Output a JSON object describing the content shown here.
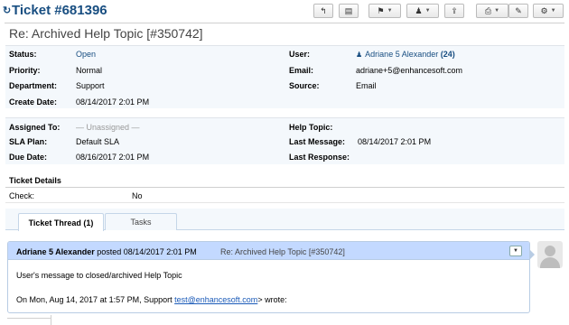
{
  "header": {
    "refresh_icon": "refresh-icon",
    "title": "Ticket #681396",
    "toolbar": [
      {
        "name": "back-button",
        "icon": "↰",
        "caret": false
      },
      {
        "name": "note-button",
        "icon": "▤",
        "caret": false
      },
      {
        "name": "flag-button",
        "icon": "⚑",
        "caret": true
      },
      {
        "name": "assign-button",
        "icon": "♟",
        "caret": true
      },
      {
        "name": "transfer-button",
        "icon": "⇪",
        "caret": false
      },
      {
        "name": "print-button",
        "icon": "⎙",
        "caret": true
      },
      {
        "name": "edit-button",
        "icon": "✎",
        "caret": false
      },
      {
        "name": "settings-button",
        "icon": "⚙",
        "caret": true
      }
    ]
  },
  "subject": "Re: Archived Help Topic [#350742]",
  "info": {
    "status_label": "Status:",
    "status": "Open",
    "priority_label": "Priority:",
    "priority": "Normal",
    "department_label": "Department:",
    "department": "Support",
    "create_date_label": "Create Date:",
    "create_date": "08/14/2017 2:01 PM",
    "user_label": "User:",
    "user_name": "Adriane 5 Alexander",
    "user_count": "(24)",
    "email_label": "Email:",
    "email": "adriane+5@enhancesoft.com",
    "source_label": "Source:",
    "source": "Email"
  },
  "assignment": {
    "assigned_to_label": "Assigned To:",
    "assigned_to": "— Unassigned —",
    "sla_plan_label": "SLA Plan:",
    "sla_plan": "Default SLA",
    "due_date_label": "Due Date:",
    "due_date": "08/16/2017 2:01 PM",
    "help_topic_label": "Help Topic:",
    "help_topic": "",
    "last_message_label": "Last Message:",
    "last_message": "08/14/2017 2:01 PM",
    "last_response_label": "Last Response:",
    "last_response": ""
  },
  "details": {
    "title": "Ticket Details",
    "check_label": "Check:",
    "check_value": "No"
  },
  "tabs": [
    {
      "label": "Ticket Thread (1)",
      "active": true
    },
    {
      "label": "Tasks",
      "active": false
    }
  ],
  "thread": {
    "author": "Adriane 5 Alexander",
    "posted_text": "posted 08/14/2017 2:01 PM",
    "subject": "Re: Archived Help Topic [#350742]",
    "body_line1": "User's message to closed/archived Help Topic",
    "body_line2_prefix": "On Mon, Aug 14, 2017 at 1:57 PM, Support ",
    "body_line2_link": "test@enhancesoft.com",
    "body_line2_suffix": "> wrote:"
  },
  "colors": {
    "title_blue": "#184e81",
    "panel_bg": "#f4f8fc",
    "thread_header": "#c3d9ff",
    "link": "#1a5ab8"
  }
}
